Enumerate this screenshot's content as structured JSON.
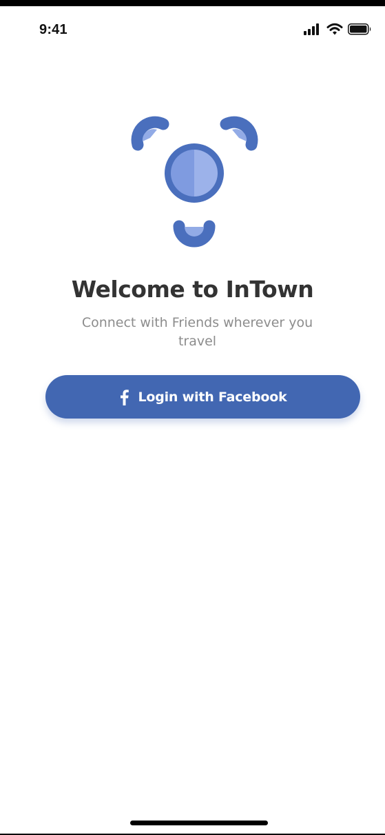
{
  "status_bar": {
    "time": "9:41",
    "icons": [
      "cellular-signal-icon",
      "wifi-icon",
      "battery-icon"
    ]
  },
  "logo": {
    "icon": "intown-logo-icon",
    "colors": {
      "primary": "#4a6fbd",
      "light": "#92abe6"
    }
  },
  "welcome": {
    "title": "Welcome to InTown",
    "subtitle": "Connect with Friends wherever you travel"
  },
  "login": {
    "icon": "facebook-icon",
    "label": "Login with Facebook",
    "color": "#4267b2"
  }
}
